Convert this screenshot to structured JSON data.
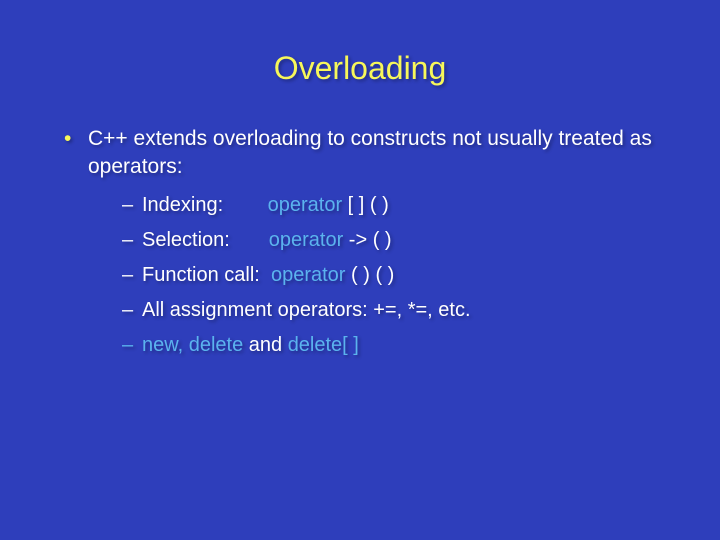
{
  "title": "Overloading",
  "bullet1": "C++ extends overloading to constructs not usually treated as operators:",
  "sub": {
    "s1_label": "Indexing:",
    "s1_kw": "operator",
    "s1_sig": " [ ] ( )",
    "s2_label": "Selection:",
    "s2_kw": "operator",
    "s2_sig": " -> ( )",
    "s3_label": "Function call:",
    "s3_kw": "operator",
    "s3_sig": " ( ) ( )",
    "s4_label": "All assignment operators: +=, *=, etc.",
    "s5_a": "new, delete",
    "s5_mid": " and ",
    "s5_b": "delete[ ]"
  }
}
